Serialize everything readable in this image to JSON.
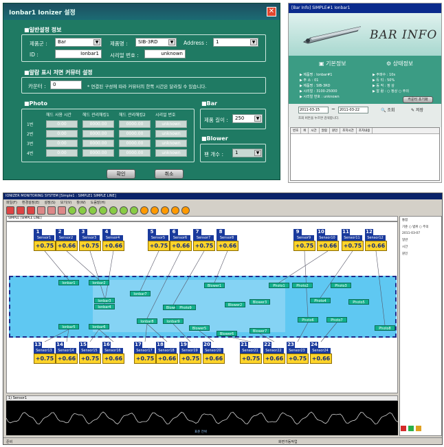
{
  "dialog": {
    "title": "Ionbar1 Ionizer 설정",
    "general": {
      "heading": "■일반설정 정보",
      "type_label": "제품군 :",
      "type_value": "Bar",
      "name_label": "제품명 :",
      "name_value": "SIB-3RD",
      "address_label": "Address :",
      "address_value": "1",
      "id_label": "ID :",
      "id_value": "Ionbar1",
      "serial_label": "시리얼 번호 :",
      "serial_value": "unknown"
    },
    "display": {
      "heading": "■알람 표시 저면 커뮤터 설정",
      "count_label": "카운터 :",
      "count_value": "0",
      "note": "* 연결된 구성에 따라 커뮤터의 한쪽 시간은 달라질 수 있습니다."
    },
    "photo": {
      "heading": "■Photo",
      "headers": [
        "헤드 사용 시간",
        "헤드 관리해킹1",
        "헤드 관리해킹2",
        "시리얼 번호"
      ],
      "rows": [
        {
          "label": "1번",
          "cells": [
            "0:00",
            "0000.00",
            "0000.00",
            "unknown"
          ]
        },
        {
          "label": "2번",
          "cells": [
            "0:00",
            "0000.00",
            "0000.00",
            "unknown"
          ]
        },
        {
          "label": "3번",
          "cells": [
            "0:00",
            "0000.00",
            "0000.00",
            "unknown"
          ]
        },
        {
          "label": "4번",
          "cells": [
            "0:00",
            "0000.00",
            "0000.00",
            "unknown"
          ]
        }
      ]
    },
    "bar": {
      "heading": "■Bar",
      "length_label": "제품 길이 :",
      "length_value": "250"
    },
    "blower": {
      "heading": "■Blower",
      "count_label": "팬 개수 :",
      "count_value": "1"
    },
    "ok_label": "확인",
    "cancel_label": "취소"
  },
  "barinfo": {
    "title": "[Bar Info]  SIMPLE#1  Ionbar1",
    "heading": "BAR INFO",
    "basic_heading": "기본정보",
    "status_heading": "상태정보",
    "basic_items": [
      "▶ 제품명 : Ionbar#1",
      "▶ 주 소 : 01",
      "▶ 제품명 : SIB-3RD",
      "▶ 시리얼 : 3100-25000",
      "▶ 시리얼 번호 : unknown"
    ],
    "status_items": [
      "▶ 주파수 : 10s",
      "▶ 듀 티 : 50%",
      "▶ 동 작 : 정 상",
      "▶ 알 람 : ○ 정상    ○ 주의"
    ],
    "reset_button": "카운터 초기화",
    "date_from": "2011-03-15",
    "date_sep": "~",
    "date_to": "2011-03-22",
    "query_note": "조회 버튼을 누르면 검색합니다.",
    "query_label": "조회",
    "save_label": "저장",
    "log_headers": [
      "번호",
      "위",
      "시간",
      "알람",
      "원인",
      "조치시간",
      "조치내용"
    ]
  },
  "monitor": {
    "title": "IONIZER MONITORING SYSTEM [Simple1 : SIMPLE1 SIMPLE LINE]",
    "menu": [
      "파일(F)",
      "환경설정(E)",
      "설정(S)",
      "보기(V)",
      "창(W)",
      "도움말(H)"
    ],
    "tab": "SIMPLE [SIMPLE LINE]",
    "top_sensors": [
      {
        "num": "1",
        "name": "Sensor1",
        "value": "+0.75"
      },
      {
        "num": "2",
        "name": "Sensor2",
        "value": "+0.66"
      },
      {
        "num": "3",
        "name": "Sensor3",
        "value": "+0.75"
      },
      {
        "num": "4",
        "name": "Sensor4",
        "value": "+0.66"
      },
      {
        "num": "5",
        "name": "Sensor5",
        "value": "+0.75"
      },
      {
        "num": "6",
        "name": "Sensor6",
        "value": "+0.66"
      },
      {
        "num": "7",
        "name": "Sensor7",
        "value": "+0.75"
      },
      {
        "num": "8",
        "name": "Sensor8",
        "value": "+0.66"
      },
      {
        "num": "9",
        "name": "Sensor9",
        "value": "+0.75"
      },
      {
        "num": "10",
        "name": "Sensor10",
        "value": "+0.66"
      },
      {
        "num": "11",
        "name": "Sensor11",
        "value": "+0.75"
      },
      {
        "num": "12",
        "name": "Sensor12",
        "value": "+0.66"
      }
    ],
    "bottom_sensors": [
      {
        "num": "13",
        "name": "Sensor13",
        "value": "+0.75"
      },
      {
        "num": "14",
        "name": "Sensor14",
        "value": "+0.66"
      },
      {
        "num": "15",
        "name": "Sensor15",
        "value": "+0.75"
      },
      {
        "num": "16",
        "name": "Sensor16",
        "value": "+0.66"
      },
      {
        "num": "17",
        "name": "Sensor17",
        "value": "+0.75"
      },
      {
        "num": "18",
        "name": "Sensor18",
        "value": "+0.66"
      },
      {
        "num": "19",
        "name": "Sensor19",
        "value": "+0.75"
      },
      {
        "num": "20",
        "name": "Sensor20",
        "value": "+0.66"
      },
      {
        "num": "21",
        "name": "Sensor21",
        "value": "+0.75"
      },
      {
        "num": "22",
        "name": "Sensor22",
        "value": "+0.66"
      },
      {
        "num": "23",
        "name": "Sensor23",
        "value": "+0.75"
      },
      {
        "num": "24",
        "name": "Sensor24",
        "value": "+0.66"
      }
    ],
    "devices": [
      "Ionbar1",
      "Ionbar2",
      "Ionbar3",
      "Ionbar4",
      "Ionbar5",
      "Ionbar6",
      "Ionbar7",
      "Ionbar8",
      "Ionbar9",
      "Blower1",
      "Blower2",
      "Blower3",
      "Blower4",
      "Blower5",
      "Blower6",
      "Blower7",
      "Photo1",
      "Photo2",
      "Photo3",
      "Photo4",
      "Photo5",
      "Photo6",
      "Photo7",
      "Photo8",
      "Photo9"
    ],
    "graph_title": "1) Sensor1",
    "graph_caption": "표준 전위",
    "side_labels": [
      "통합",
      "기준 ○ 범위 ○ 주의",
      "2011-03-07",
      "일반",
      "시간",
      "원인"
    ],
    "status_left": "준비",
    "status_mid": "화면가동작업"
  }
}
